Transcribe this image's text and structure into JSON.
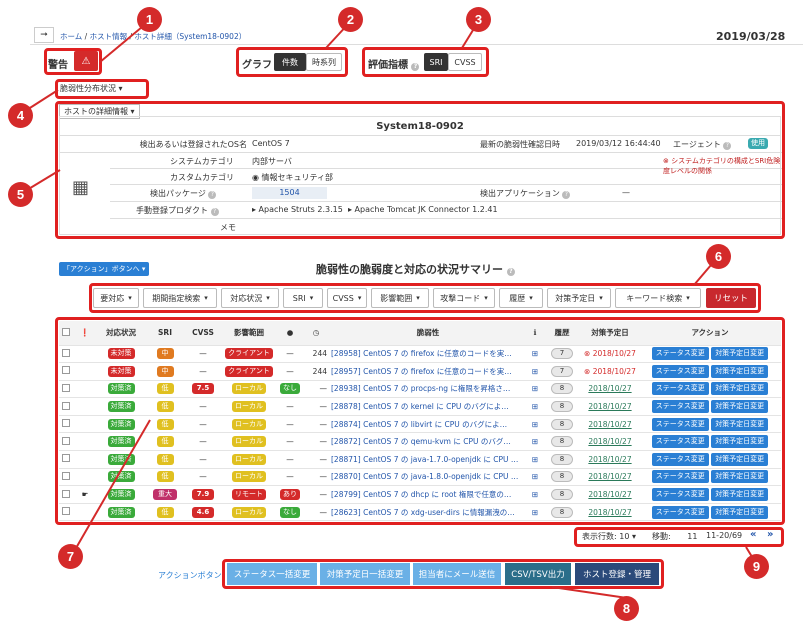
{
  "nav": {
    "home": "ホーム",
    "hosts": "ホスト情報",
    "detail": "ホスト詳細（System18-0902）",
    "date": "2019/03/28",
    "sep": "/"
  },
  "warning": {
    "label": "警告"
  },
  "graph": {
    "label": "グラフ",
    "count": "件数",
    "timeseries": "時系列"
  },
  "eval": {
    "label": "評価指標",
    "sri": "SRI",
    "cvss": "CVSS"
  },
  "vuln_dist": {
    "label": "脆弱性分布状況"
  },
  "host_detail": {
    "tab": "ホストの詳細情報",
    "hostname": "System18-0902",
    "os_label": "検出あるいは登録されたOS名",
    "os_value": "CentOS 7",
    "latest_label": "最新の脆弱性確認日時",
    "latest_value": "2019/03/12 16:44:40",
    "agent_label": "エージェント",
    "agent_value": "使用",
    "syscat_label": "システムカテゴリ",
    "syscat_value": "内部サーバ",
    "syscat_note": "⊗ システムカテゴリの構成とSRI危険度レベルの関係",
    "custcat_label": "カスタムカテゴリ",
    "custcat_value": "◉ 情報セキュリティ部",
    "pkg_label": "検出パッケージ",
    "pkg_value": "1504",
    "app_label": "検出アプリケーション",
    "app_value": "—",
    "manual_label": "手動登録プロダクト",
    "manual_p1": "▸ Apache Struts 2.3.15",
    "manual_p2": "▸ Apache Tomcat JK Connector 1.2.41",
    "memo_label": "メモ"
  },
  "action_link": "「アクション」ボタンへ ▾",
  "summary_title": "脆弱性の脆弱度と対応の状況サマリー",
  "filters": [
    "要対応",
    "期間指定検索",
    "対応状況",
    "SRI",
    "CVSS",
    "影響範囲",
    "攻撃コード",
    "履歴",
    "対策予定日",
    "キーワード検索"
  ],
  "reset": "リセット",
  "headers": {
    "status": "対応状況",
    "sri": "SRI",
    "cvss": "CVSS",
    "scope": "影響範囲",
    "vuln": "脆弱性",
    "history": "履歴",
    "plan": "対策予定日",
    "action": "アクション"
  },
  "rows": [
    {
      "status": "未対策",
      "sri": "中",
      "cvss": "—",
      "scope": "クライアント",
      "exploit": "—",
      "days": "244",
      "vuln": "[28958] CentOS 7 の firefox に任意のコードを実…",
      "hist": "7",
      "plan": "2018/10/27",
      "overdue": true,
      "flag": ""
    },
    {
      "status": "未対策",
      "sri": "中",
      "cvss": "—",
      "scope": "クライアント",
      "exploit": "—",
      "days": "244",
      "vuln": "[28957] CentOS 7 の firefox に任意のコードを実…",
      "hist": "7",
      "plan": "2018/10/27",
      "overdue": true,
      "flag": ""
    },
    {
      "status": "対策済",
      "sri": "低",
      "cvss": "7.5",
      "scope": "ローカル",
      "exploit": "なし",
      "days": "—",
      "vuln": "[28938] CentOS 7 の procps-ng に権限を昇格さ…",
      "hist": "8",
      "plan": "2018/10/27",
      "overdue": false,
      "flag": ""
    },
    {
      "status": "対策済",
      "sri": "低",
      "cvss": "—",
      "scope": "ローカル",
      "exploit": "—",
      "days": "—",
      "vuln": "[28878] CentOS 7 の kernel に CPU のバグによ…",
      "hist": "8",
      "plan": "2018/10/27",
      "overdue": false,
      "flag": ""
    },
    {
      "status": "対策済",
      "sri": "低",
      "cvss": "—",
      "scope": "ローカル",
      "exploit": "—",
      "days": "—",
      "vuln": "[28874] CentOS 7 の libvirt に CPU のバグによ…",
      "hist": "8",
      "plan": "2018/10/27",
      "overdue": false,
      "flag": ""
    },
    {
      "status": "対策済",
      "sri": "低",
      "cvss": "—",
      "scope": "ローカル",
      "exploit": "—",
      "days": "—",
      "vuln": "[28872] CentOS 7 の qemu-kvm に CPU のバグ…",
      "hist": "8",
      "plan": "2018/10/27",
      "overdue": false,
      "flag": ""
    },
    {
      "status": "対策済",
      "sri": "低",
      "cvss": "—",
      "scope": "ローカル",
      "exploit": "—",
      "days": "—",
      "vuln": "[28871] CentOS 7 の java-1.7.0-openjdk に CPU …",
      "hist": "8",
      "plan": "2018/10/27",
      "overdue": false,
      "flag": ""
    },
    {
      "status": "対策済",
      "sri": "低",
      "cvss": "—",
      "scope": "ローカル",
      "exploit": "—",
      "days": "—",
      "vuln": "[28870] CentOS 7 の java-1.8.0-openjdk に CPU …",
      "hist": "8",
      "plan": "2018/10/27",
      "overdue": false,
      "flag": ""
    },
    {
      "status": "対策済",
      "sri": "重大",
      "cvss": "7.9",
      "scope": "リモート",
      "exploit": "あり",
      "days": "—",
      "vuln": "[28799] CentOS 7 の dhcp に root 権限で任意の…",
      "hist": "8",
      "plan": "2018/10/27",
      "overdue": false,
      "flag": "hand"
    },
    {
      "status": "対策済",
      "sri": "低",
      "cvss": "4.6",
      "scope": "ローカル",
      "exploit": "なし",
      "days": "—",
      "vuln": "[28623] CentOS 7 の xdg-user-dirs に情報漏洩の…",
      "hist": "8",
      "plan": "2018/10/27",
      "overdue": false,
      "flag": ""
    }
  ],
  "row_actions": {
    "status_change": "ステータス変更",
    "plan_change": "対策予定日変更"
  },
  "pager": {
    "rows_label": "表示行数:",
    "rows_value": "10",
    "move_label": "移動:",
    "move_value": "11",
    "range": "11-20/69",
    "prev": "«",
    "next": "»"
  },
  "bottom": {
    "label": "アクションボタン",
    "bulk_status": "ステータス一括変更",
    "bulk_plan": "対策予定日一括変更",
    "mail": "担当者にメール送信",
    "csv": "CSV/TSV出力",
    "host": "ホスト登録・管理"
  },
  "callouts": [
    "1",
    "2",
    "3",
    "4",
    "5",
    "6",
    "7",
    "8",
    "9"
  ],
  "colors": {
    "red": "#d42a2a",
    "green": "#3aaa3a",
    "orange": "#e07a20",
    "yellow": "#e0c020",
    "blue": "#2a7fd4",
    "navy": "#2b4a7a"
  }
}
